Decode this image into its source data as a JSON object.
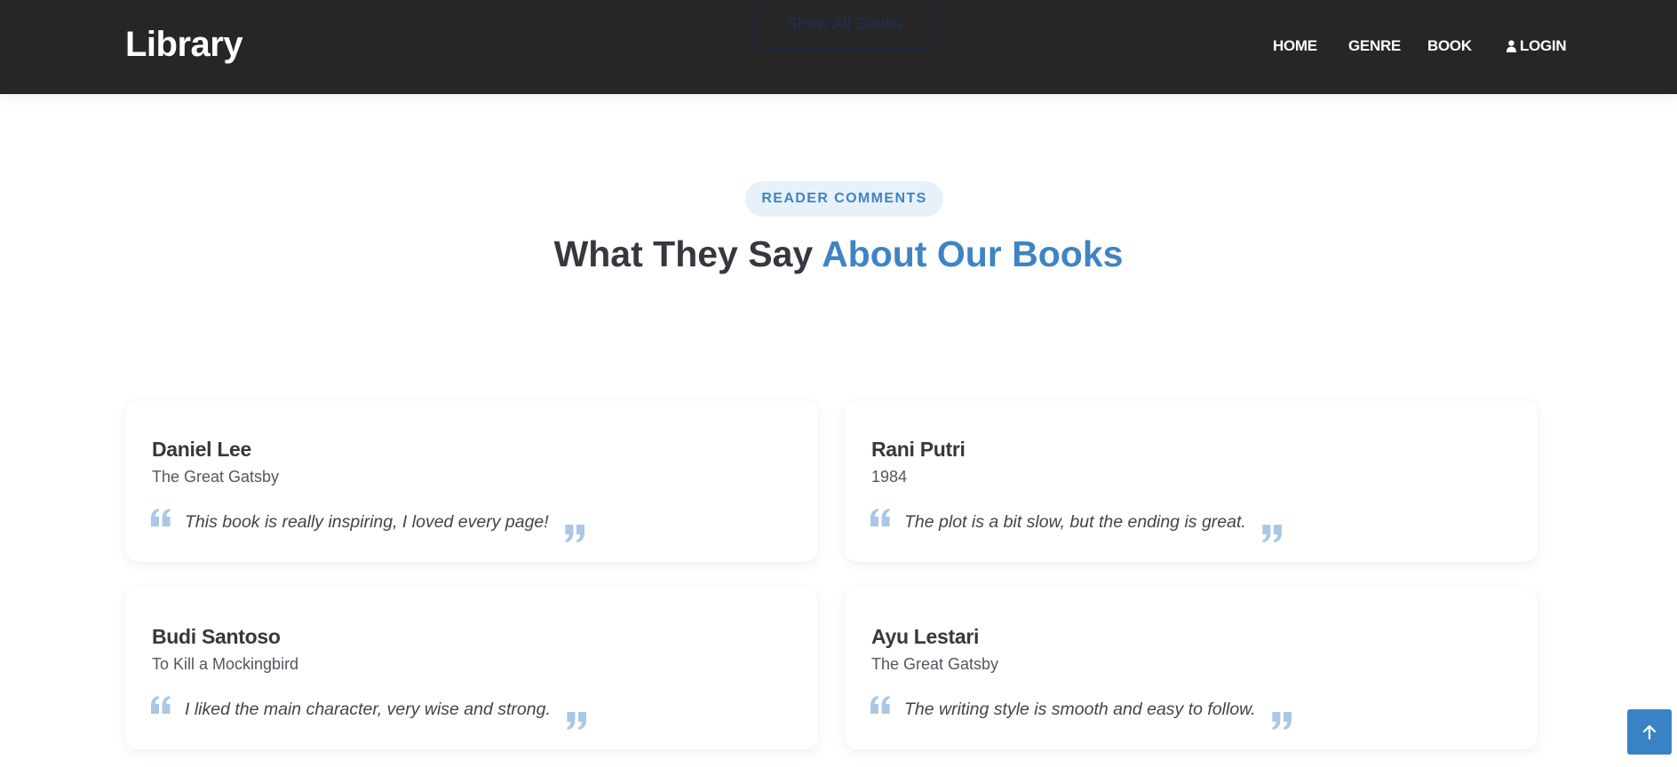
{
  "header": {
    "logo": "Library",
    "show_all_button": "Show All Books",
    "nav": {
      "home": "HOME",
      "genre": "GENRE",
      "book": "BOOK",
      "login": "LOGIN"
    }
  },
  "section": {
    "badge": "READER COMMENTS",
    "title_prefix": "What They Say ",
    "title_accent": "About Our Books"
  },
  "comments": [
    {
      "name": "Daniel Lee",
      "book": "The Great Gatsby",
      "quote": "This book is really inspiring, I loved every page!"
    },
    {
      "name": "Rani Putri",
      "book": "1984",
      "quote": "The plot is a bit slow, but the ending is great."
    },
    {
      "name": "Budi Santoso",
      "book": "To Kill a Mockingbird",
      "quote": "I liked the main character, very wise and strong."
    },
    {
      "name": "Ayu Lestari",
      "book": "The Great Gatsby",
      "quote": "The writing style is smooth and easy to follow."
    }
  ],
  "colors": {
    "header_bg": "#262626",
    "accent": "#3f84c4",
    "quote_mark": "#a9c8e6",
    "back_to_top_bg": "#3a82c6"
  },
  "icons": {
    "login": "user-icon",
    "quote_open": "quote-open-icon",
    "quote_close": "quote-close-icon",
    "back_to_top": "arrow-up-icon"
  }
}
